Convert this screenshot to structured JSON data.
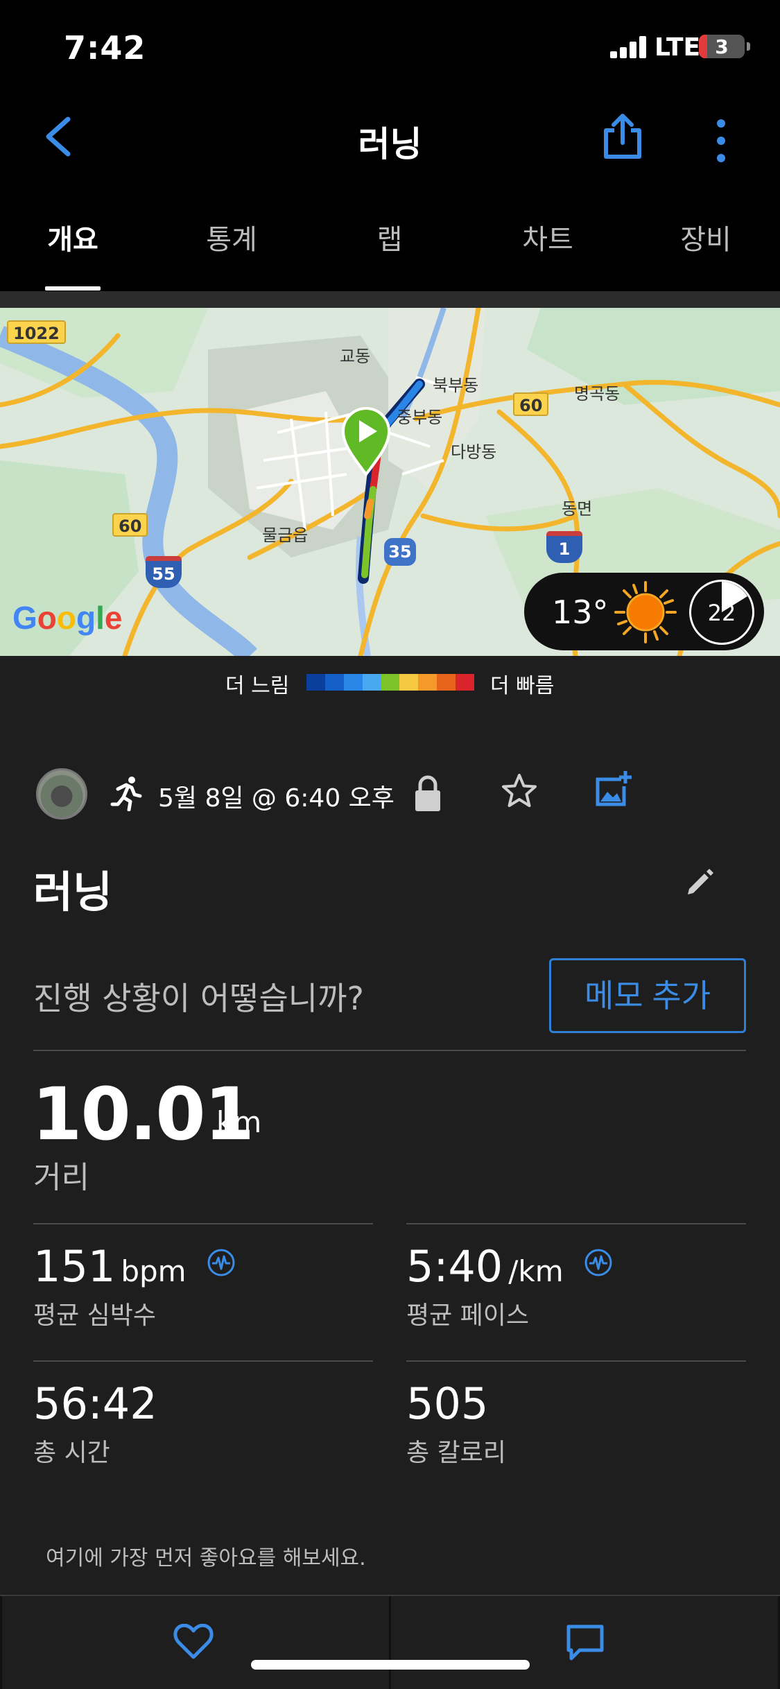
{
  "status_bar": {
    "time": "7:42",
    "network": "LTE",
    "battery": "3",
    "battery_color": "#e23b3b"
  },
  "header": {
    "title": "러닝",
    "back_icon": "chevron-left-icon",
    "share_icon": "share-icon",
    "more_icon": "more-vertical-icon"
  },
  "tabs": [
    {
      "label": "개요",
      "active": true
    },
    {
      "label": "통계",
      "active": false
    },
    {
      "label": "랩",
      "active": false
    },
    {
      "label": "차트",
      "active": false
    },
    {
      "label": "장비",
      "active": false
    }
  ],
  "map": {
    "place_labels": [
      "교동",
      "북부동",
      "중부동",
      "다방동",
      "명곡동",
      "동면",
      "물금읍"
    ],
    "road_badges": [
      "1022",
      "60",
      "60"
    ],
    "highway_shields": [
      "55",
      "1"
    ],
    "local_shields": [
      "35"
    ],
    "logo": "Google",
    "weather": {
      "temperature": "13°",
      "condition": "sun-icon",
      "wind": "22"
    }
  },
  "pace_legend": {
    "slow_label": "더 느림",
    "fast_label": "더 빠름",
    "colors": [
      "#0b3f9e",
      "#1460c8",
      "#2a86e6",
      "#4aa8f0",
      "#7cc42a",
      "#f5c842",
      "#f59a2a",
      "#e8641c",
      "#d8242a"
    ]
  },
  "activity": {
    "date": "5월 8일 @ 6:40 오후",
    "title": "러닝",
    "memo_prompt": "진행 상황이 어떻습니까?",
    "memo_button": "메모 추가"
  },
  "stats": {
    "distance": {
      "value": "10.01",
      "unit": "km",
      "label": "거리"
    },
    "heart_rate": {
      "value": "151",
      "unit": "bpm",
      "label": "평균 심박수"
    },
    "pace": {
      "value": "5:40",
      "unit": "/km",
      "label": "평균 페이스"
    },
    "time": {
      "value": "56:42",
      "label": "총 시간"
    },
    "calories": {
      "value": "505",
      "label": "총 칼로리"
    }
  },
  "like_hint": "여기에 가장 먼저 좋아요를 해보세요.",
  "accent_color": "#3a8ce6"
}
